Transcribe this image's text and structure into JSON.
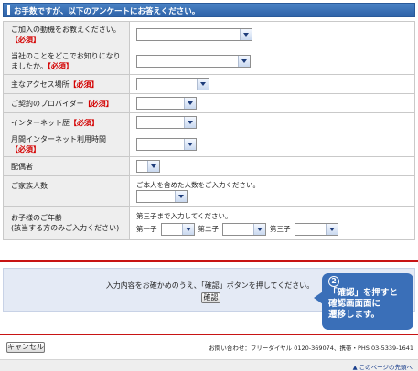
{
  "header": {
    "title": "お手数ですが、以下のアンケートにお答えください。"
  },
  "required_tag": "【必須】",
  "rows": [
    {
      "label": "ご加入の動機をお教えください。"
    },
    {
      "label": "当社のことをどこでお知りになりましたか。"
    },
    {
      "label": "主なアクセス場所"
    },
    {
      "label": "ご契約のプロバイダー"
    },
    {
      "label": "インターネット歴"
    },
    {
      "label": "月間インターネット利用時間"
    },
    {
      "label": "配偶者"
    },
    {
      "label": "ご家族人数",
      "note": "ご本人を含めた人数をご入力ください。"
    },
    {
      "label": "お子様のご年齢\n(該当する方のみご入力ください)",
      "note": "第三子まで入力してください。",
      "children": [
        "第一子",
        "第二子",
        "第三子"
      ]
    }
  ],
  "confirm": {
    "text": "入力内容をお確かめのうえ、「確認」ボタンを押してください。",
    "button": "確認"
  },
  "callout": {
    "number": "2",
    "text": "「確認」を押すと\n確認画面面に\n遷移します。"
  },
  "footer": {
    "cancel": "キャンセル",
    "contact": "お問い合わせ：フリーダイヤル 0120-369074、携帯・PHS 03-5339-1641",
    "page_top": "▲ このページの先頭へ"
  },
  "colors": {
    "header_blue": "#3a6fb8",
    "required_red": "#d40000",
    "divider_red": "#c81414"
  }
}
